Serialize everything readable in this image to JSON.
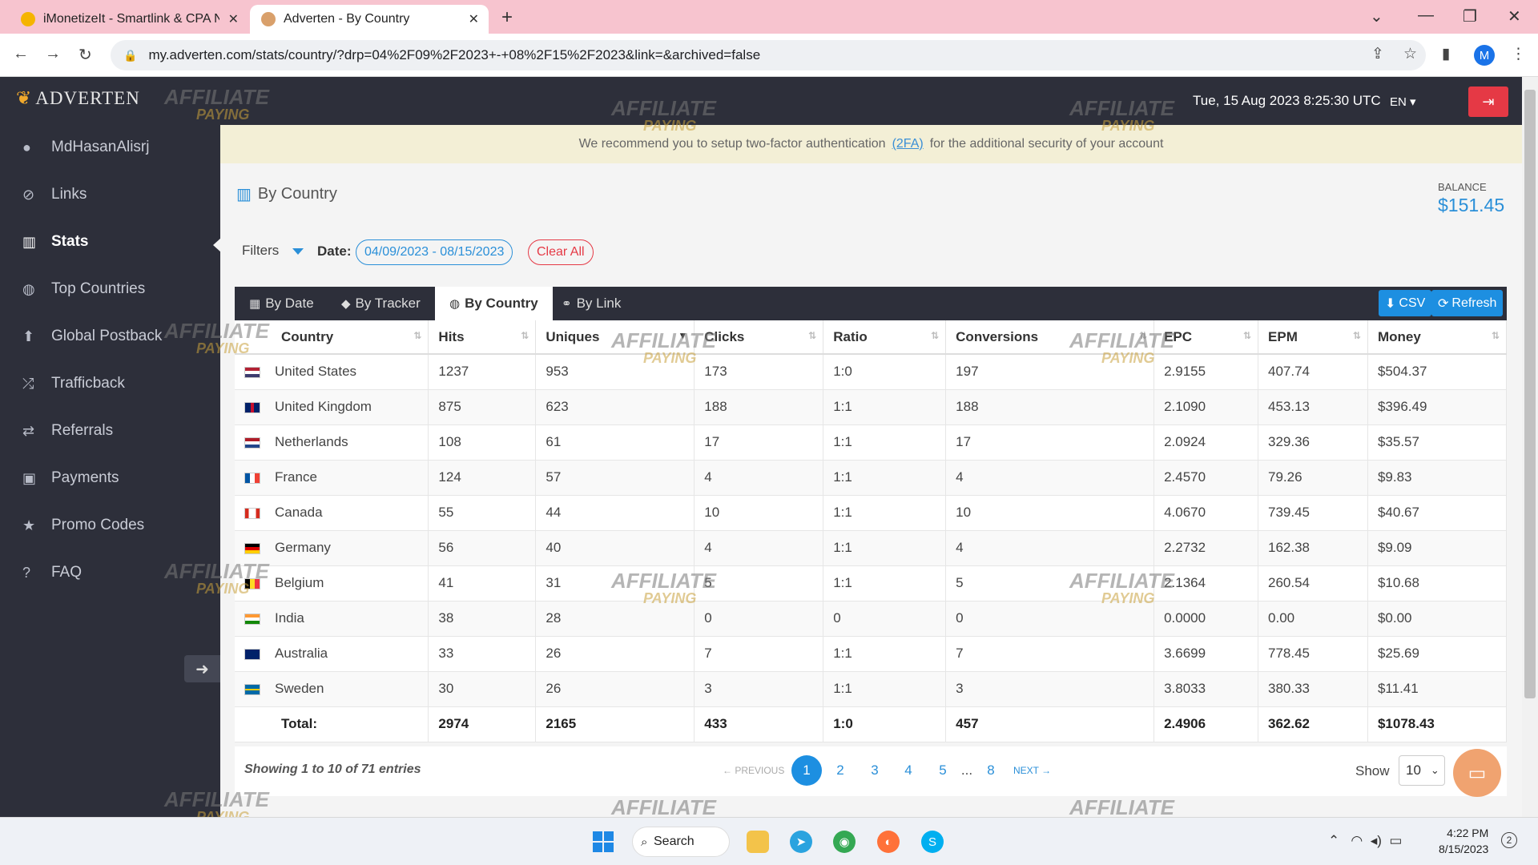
{
  "browser": {
    "tabs": [
      {
        "title": "iMonetizeIt - Smartlink & CPA Ne",
        "icon": "imonetizeit-favicon"
      },
      {
        "title": "Adverten - By Country",
        "icon": "adverten-favicon"
      }
    ],
    "url": "my.adverten.com/stats/country/?drp=04%2F09%2F2023+-+08%2F15%2F2023&link=&archived=false",
    "profile_initial": "M"
  },
  "app": {
    "logo": "ADVERTEN",
    "datetime": "Tue, 15 Aug 2023 8:25:30 UTC",
    "lang": "EN",
    "notice": {
      "text_before": "We recommend you to setup two-factor authentication",
      "link": "(2FA)",
      "text_after": "for the additional security of your account"
    }
  },
  "sidebar": {
    "items": [
      {
        "label": "MdHasanAlisrj",
        "icon": "user-icon"
      },
      {
        "label": "Links",
        "icon": "link-icon"
      },
      {
        "label": "Stats",
        "icon": "bar-chart-icon",
        "active": true
      },
      {
        "label": "Top Countries",
        "icon": "globe-icon"
      },
      {
        "label": "Global Postback",
        "icon": "arrow-up-icon"
      },
      {
        "label": "Trafficback",
        "icon": "shuffle-icon"
      },
      {
        "label": "Referrals",
        "icon": "exchange-icon"
      },
      {
        "label": "Payments",
        "icon": "money-icon"
      },
      {
        "label": "Promo Codes",
        "icon": "star-icon"
      },
      {
        "label": "FAQ",
        "icon": "question-icon"
      }
    ]
  },
  "page": {
    "title": "By Country",
    "balance_label": "BALANCE",
    "balance_value": "$151.45",
    "filters_label": "Filters",
    "date_label": "Date:",
    "date_range": "04/09/2023 - 08/15/2023",
    "clear_all": "Clear All",
    "report_tabs": [
      "By Date",
      "By Tracker",
      "By Country",
      "By Link"
    ],
    "active_tab": "By Country",
    "csv_label": "CSV",
    "refresh_label": "Refresh"
  },
  "table": {
    "columns": [
      "Country",
      "Hits",
      "Uniques",
      "Clicks",
      "Ratio",
      "Conversions",
      "EPC",
      "EPM",
      "Money"
    ],
    "rows": [
      {
        "country": "United States",
        "flag": "us",
        "hits": "1237",
        "uniques": "953",
        "clicks": "173",
        "ratio": "1:0",
        "conversions": "197",
        "epc": "2.9155",
        "epm": "407.74",
        "money": "$504.37"
      },
      {
        "country": "United Kingdom",
        "flag": "gb",
        "hits": "875",
        "uniques": "623",
        "clicks": "188",
        "ratio": "1:1",
        "conversions": "188",
        "epc": "2.1090",
        "epm": "453.13",
        "money": "$396.49"
      },
      {
        "country": "Netherlands",
        "flag": "nl",
        "hits": "108",
        "uniques": "61",
        "clicks": "17",
        "ratio": "1:1",
        "conversions": "17",
        "epc": "2.0924",
        "epm": "329.36",
        "money": "$35.57"
      },
      {
        "country": "France",
        "flag": "fr",
        "hits": "124",
        "uniques": "57",
        "clicks": "4",
        "ratio": "1:1",
        "conversions": "4",
        "epc": "2.4570",
        "epm": "79.26",
        "money": "$9.83"
      },
      {
        "country": "Canada",
        "flag": "ca",
        "hits": "55",
        "uniques": "44",
        "clicks": "10",
        "ratio": "1:1",
        "conversions": "10",
        "epc": "4.0670",
        "epm": "739.45",
        "money": "$40.67"
      },
      {
        "country": "Germany",
        "flag": "de",
        "hits": "56",
        "uniques": "40",
        "clicks": "4",
        "ratio": "1:1",
        "conversions": "4",
        "epc": "2.2732",
        "epm": "162.38",
        "money": "$9.09"
      },
      {
        "country": "Belgium",
        "flag": "be",
        "hits": "41",
        "uniques": "31",
        "clicks": "5",
        "ratio": "1:1",
        "conversions": "5",
        "epc": "2.1364",
        "epm": "260.54",
        "money": "$10.68"
      },
      {
        "country": "India",
        "flag": "in",
        "hits": "38",
        "uniques": "28",
        "clicks": "0",
        "ratio": "0",
        "conversions": "0",
        "epc": "0.0000",
        "epm": "0.00",
        "money": "$0.00"
      },
      {
        "country": "Australia",
        "flag": "au",
        "hits": "33",
        "uniques": "26",
        "clicks": "7",
        "ratio": "1:1",
        "conversions": "7",
        "epc": "3.6699",
        "epm": "778.45",
        "money": "$25.69"
      },
      {
        "country": "Sweden",
        "flag": "se",
        "hits": "30",
        "uniques": "26",
        "clicks": "3",
        "ratio": "1:1",
        "conversions": "3",
        "epc": "3.8033",
        "epm": "380.33",
        "money": "$11.41"
      }
    ],
    "total": {
      "label": "Total:",
      "hits": "2974",
      "uniques": "2165",
      "clicks": "433",
      "ratio": "1:0",
      "conversions": "457",
      "epc": "2.4906",
      "epm": "362.62",
      "money": "$1078.43"
    }
  },
  "pagination": {
    "showing": "Showing 1 to 10 of 71 entries",
    "previous": "← PREVIOUS",
    "pages": [
      "1",
      "2",
      "3",
      "4",
      "5",
      "...",
      "8"
    ],
    "current": "1",
    "next": "NEXT →",
    "show_label": "Show",
    "page_size": "10"
  },
  "watermark": {
    "line1": "AFFILIATE",
    "line2": "PAYING"
  },
  "taskbar": {
    "search": "Search",
    "time": "4:22 PM",
    "date": "8/15/2023",
    "notifications": "2"
  },
  "colors": {
    "accent": "#1d8fe1",
    "sidebar_bg": "#2d2f3a",
    "danger": "#e53945",
    "tab_strip_bg": "#f7c4cf",
    "notice_bg": "#f3efd6"
  }
}
